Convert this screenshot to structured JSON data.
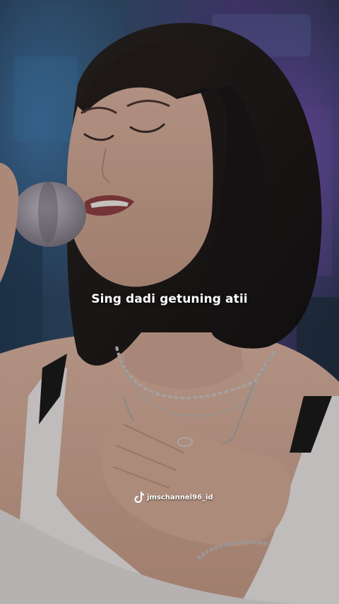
{
  "caption": {
    "text": "Sing dadi getuning atii"
  },
  "watermark": {
    "handle": "jmschannel96_id",
    "icon": "tiktok-logo-icon"
  }
}
